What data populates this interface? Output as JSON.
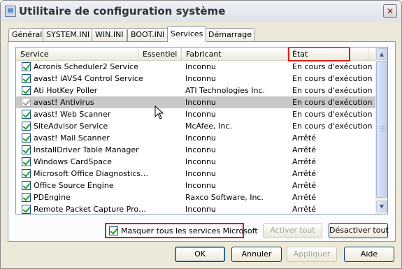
{
  "window": {
    "title": "Utilitaire de configuration système",
    "close_glyph": "✕"
  },
  "tabs": [
    "Général",
    "SYSTEM.INI",
    "WIN.INI",
    "BOOT.INI",
    "Services",
    "Démarrage"
  ],
  "active_tab": "Services",
  "columns": {
    "service": "Service",
    "essential": "Essentiel",
    "manufacturer": "Fabricant",
    "state": "État"
  },
  "services": [
    {
      "name": "Acronis Scheduler2 Service",
      "manufacturer": "Inconnu",
      "state": "En cours d'exécution",
      "checked": true
    },
    {
      "name": "avast! iAVS4 Control Service",
      "manufacturer": "Inconnu",
      "state": "En cours d'exécution",
      "checked": true
    },
    {
      "name": "Ati HotKey Poller",
      "manufacturer": "ATI Technologies Inc.",
      "state": "En cours d'exécution",
      "checked": true
    },
    {
      "name": "avast! Antivirus",
      "manufacturer": "Inconnu",
      "state": "En cours d'exécution",
      "checked": true,
      "selected": true
    },
    {
      "name": "avast! Web Scanner",
      "manufacturer": "Inconnu",
      "state": "En cours d'exécution",
      "checked": true
    },
    {
      "name": "SiteAdvisor Service",
      "manufacturer": "McAfee, Inc.",
      "state": "En cours d'exécution",
      "checked": true
    },
    {
      "name": "avast! Mail Scanner",
      "manufacturer": "Inconnu",
      "state": "Arrêté",
      "checked": true
    },
    {
      "name": "InstallDriver Table Manager",
      "manufacturer": "Inconnu",
      "state": "Arrêté",
      "checked": true
    },
    {
      "name": "Windows CardSpace",
      "manufacturer": "Inconnu",
      "state": "Arrêté",
      "checked": true
    },
    {
      "name": "Microsoft Office Diagnostics…",
      "manufacturer": "Inconnu",
      "state": "Arrêté",
      "checked": true
    },
    {
      "name": "Office Source Engine",
      "manufacturer": "Inconnu",
      "state": "Arrêté",
      "checked": true
    },
    {
      "name": "PDEngine",
      "manufacturer": "Raxco Software, Inc.",
      "state": "Arrêté",
      "checked": true
    },
    {
      "name": "Remote Packet Capture Pro…",
      "manufacturer": "Inconnu",
      "state": "Arrêté",
      "checked": true
    }
  ],
  "hide_ms": {
    "label": "Masquer tous les services Microsoft",
    "checked": true
  },
  "buttons": {
    "enable_all": "Activer tout",
    "disable_all": "Désactiver tout",
    "ok": "OK",
    "cancel": "Annuler",
    "apply": "Appliquer",
    "help": "Aide"
  },
  "accent_colors": {
    "highlight_border": "#d71d1d",
    "check": "#21a121"
  }
}
